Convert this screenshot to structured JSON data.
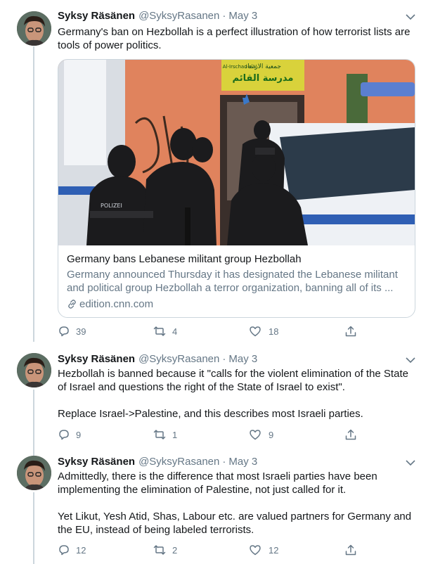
{
  "tweets": [
    {
      "author": "Syksy Räsänen",
      "handle": "@SyksyRasanen",
      "date": "May 3",
      "paragraphs": [
        "Germany's ban on Hezbollah is a perfect illustration of how terrorist lists are tools of power politics."
      ],
      "card": {
        "sign_org": "Al-Irschad e.V",
        "sign_arabic": "جمعية الارشاد",
        "sign_school": "مدرسة القائم",
        "vest_label": "POLIZEI",
        "title": "Germany bans Lebanese militant group Hezbollah",
        "description": "Germany announced Thursday it has designated the Lebanese militant and political group Hezbollah a terror organization, banning all of its ...",
        "domain": "edition.cnn.com"
      },
      "replies": "39",
      "retweets": "4",
      "likes": "18"
    },
    {
      "author": "Syksy Räsänen",
      "handle": "@SyksyRasanen",
      "date": "May 3",
      "paragraphs": [
        "Hezbollah is banned because it \"calls for the violent elimination of the State of Israel and questions the right of the State of Israel to exist\".",
        "Replace Israel->Palestine, and this describes most Israeli parties."
      ],
      "replies": "9",
      "retweets": "1",
      "likes": "9"
    },
    {
      "author": "Syksy Räsänen",
      "handle": "@SyksyRasanen",
      "date": "May 3",
      "paragraphs": [
        "Admittedly, there is the difference that most Israeli parties have been implementing the elimination of Palestine, not just called for it.",
        "Yet Likut, Yesh Atid, Shas, Labour etc. are valued partners for Germany and the EU, instead of being labeled terrorists."
      ],
      "replies": "12",
      "retweets": "2",
      "likes": "12"
    }
  ],
  "colors": {
    "text": "#14171a",
    "secondary": "#657786",
    "border": "#ccd6dd"
  },
  "icons": {
    "reply": "reply-icon",
    "retweet": "retweet-icon",
    "like": "heart-icon",
    "share": "share-icon",
    "caret": "chevron-down-icon",
    "link": "link-icon"
  }
}
